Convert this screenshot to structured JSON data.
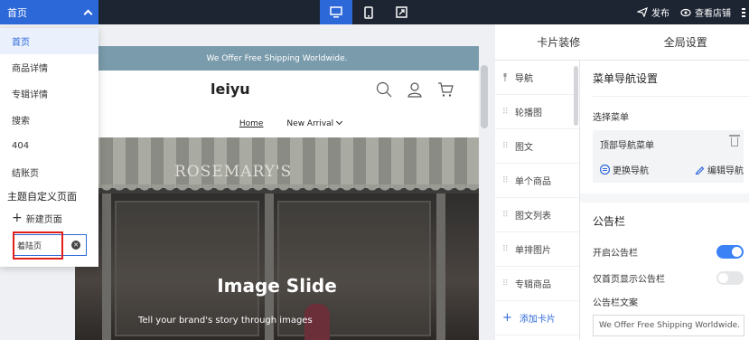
{
  "topbar": {
    "page_selector": "首页",
    "actions": {
      "publish": "发布",
      "view_store": "查看店铺"
    }
  },
  "dropdown": {
    "items": [
      "首页",
      "商品详情",
      "专辑详情",
      "搜索",
      "404",
      "结账页"
    ],
    "section_title": "主题自定义页面",
    "new_page": "新建页面",
    "input_value": "着陆页"
  },
  "preview": {
    "announcement": "We Offer Free Shipping Worldwide.",
    "logo": "leiyu",
    "nav": {
      "home": "Home",
      "new_arrival": "New Arrival"
    },
    "hero": {
      "shop_sign": "ROSEMARY'S",
      "title": "Image Slide",
      "subtitle": "Tell your brand's story through images"
    }
  },
  "panel": {
    "tabs": [
      "卡片装修",
      "全局设置"
    ],
    "cards": [
      "导航",
      "轮播图",
      "图文",
      "单个商品",
      "图文列表",
      "单排图片",
      "专辑商品"
    ],
    "add_card": "添加卡片",
    "settings": {
      "title": "菜单导航设置",
      "select_menu_label": "选择菜单",
      "menu_name": "顶部导航菜单",
      "switch_nav": "更换导航",
      "edit_nav": "编辑导航",
      "announcement_title": "公告栏",
      "enable_announcement": "开启公告栏",
      "home_only": "仅首页显示公告栏",
      "announcement_text_label": "公告栏文案",
      "announcement_text_value": "We Offer Free Shipping Worldwide."
    }
  },
  "colors": {
    "accent": "#2d68d8",
    "topbar": "#1d2533",
    "highlight": "#e0201b"
  }
}
